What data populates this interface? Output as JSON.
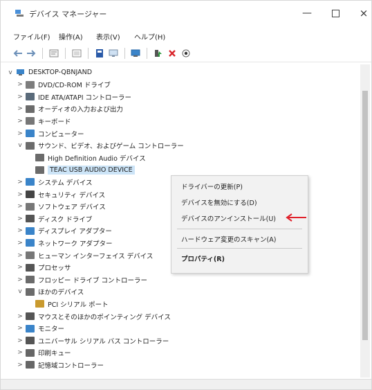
{
  "window": {
    "title": "デバイス マネージャー",
    "minimize": "—",
    "close": "×"
  },
  "menu": [
    "ファイル(F)",
    "操作(A)",
    "表示(V)",
    "ヘルプ(H)"
  ],
  "toolbar_icons": [
    "back-arrow-icon",
    "forward-arrow-icon",
    "properties-icon",
    "tree-view-icon",
    "help-icon",
    "computer-icon",
    "monitor-icon",
    "update-driver-icon",
    "delete-icon",
    "scan-icon"
  ],
  "tree": {
    "root": "DESKTOP-QBNJAND",
    "items": [
      {
        "label": "DVD/CD-ROM ドライブ",
        "chevron": ">",
        "depth": 1,
        "icon": "dvd-drive-icon",
        "color": "#7d7d7d"
      },
      {
        "label": "IDE ATA/ATAPI コントローラー",
        "chevron": ">",
        "depth": 1,
        "icon": "ide-controller-icon",
        "color": "#5a6a7a"
      },
      {
        "label": "オーディオの入力および出力",
        "chevron": ">",
        "depth": 1,
        "icon": "audio-io-icon",
        "color": "#6b6b6b"
      },
      {
        "label": "キーボード",
        "chevron": ">",
        "depth": 1,
        "icon": "keyboard-icon",
        "color": "#777"
      },
      {
        "label": "コンピューター",
        "chevron": ">",
        "depth": 1,
        "icon": "computer-icon",
        "color": "#3a84c9"
      },
      {
        "label": "サウンド、ビデオ、およびゲーム コントローラー",
        "chevron": "v",
        "depth": 1,
        "icon": "sound-icon",
        "color": "#6b6b6b"
      },
      {
        "label": "High Definition Audio デバイス",
        "chevron": "",
        "depth": 2,
        "icon": "audio-device-icon",
        "color": "#6b6b6b"
      },
      {
        "label": "TEAC USB AUDIO DEVICE",
        "chevron": "",
        "depth": 2,
        "icon": "audio-device-icon",
        "color": "#6b6b6b",
        "selected": true
      },
      {
        "label": "システム デバイス",
        "chevron": ">",
        "depth": 1,
        "icon": "system-device-icon",
        "color": "#3a84c9"
      },
      {
        "label": "セキュリティ デバイス",
        "chevron": ">",
        "depth": 1,
        "icon": "security-device-icon",
        "color": "#444"
      },
      {
        "label": "ソフトウェア デバイス",
        "chevron": ">",
        "depth": 1,
        "icon": "software-device-icon",
        "color": "#777"
      },
      {
        "label": "ディスク ドライブ",
        "chevron": ">",
        "depth": 1,
        "icon": "disk-drive-icon",
        "color": "#555"
      },
      {
        "label": "ディスプレイ アダプター",
        "chevron": ">",
        "depth": 1,
        "icon": "display-adapter-icon",
        "color": "#3a84c9"
      },
      {
        "label": "ネットワーク アダプター",
        "chevron": ">",
        "depth": 1,
        "icon": "network-adapter-icon",
        "color": "#3a84c9"
      },
      {
        "label": "ヒューマン インターフェイス デバイス",
        "chevron": ">",
        "depth": 1,
        "icon": "hid-icon",
        "color": "#777"
      },
      {
        "label": "プロセッサ",
        "chevron": ">",
        "depth": 1,
        "icon": "processor-icon",
        "color": "#555"
      },
      {
        "label": "フロッピー ドライブ コントローラー",
        "chevron": ">",
        "depth": 1,
        "icon": "floppy-controller-icon",
        "color": "#6b6b6b"
      },
      {
        "label": "ほかのデバイス",
        "chevron": "v",
        "depth": 1,
        "icon": "other-devices-icon",
        "color": "#6b6b6b"
      },
      {
        "label": "PCI シリアル ポート",
        "chevron": "",
        "depth": 2,
        "icon": "warning-device-icon",
        "color": "#c99a2e"
      },
      {
        "label": "マウスとそのほかのポインティング デバイス",
        "chevron": ">",
        "depth": 1,
        "icon": "mouse-icon",
        "color": "#555"
      },
      {
        "label": "モニター",
        "chevron": ">",
        "depth": 1,
        "icon": "monitor-icon",
        "color": "#3a84c9"
      },
      {
        "label": "ユニバーサル シリアル バス コントローラー",
        "chevron": ">",
        "depth": 1,
        "icon": "usb-controller-icon",
        "color": "#555"
      },
      {
        "label": "印刷キュー",
        "chevron": ">",
        "depth": 1,
        "icon": "print-queue-icon",
        "color": "#666"
      },
      {
        "label": "記憶域コントローラー",
        "chevron": ">",
        "depth": 1,
        "icon": "storage-controller-icon",
        "color": "#666"
      }
    ]
  },
  "context_menu": {
    "items": [
      "ドライバーの更新(P)",
      "デバイスを無効にする(D)",
      "デバイスのアンインストール(U)",
      "ハードウェア変更のスキャン(A)",
      "プロパティ(R)"
    ]
  },
  "colors": {
    "selection": "#cce4f7",
    "arrow": "#e0202a",
    "delete": "#d9252b"
  }
}
